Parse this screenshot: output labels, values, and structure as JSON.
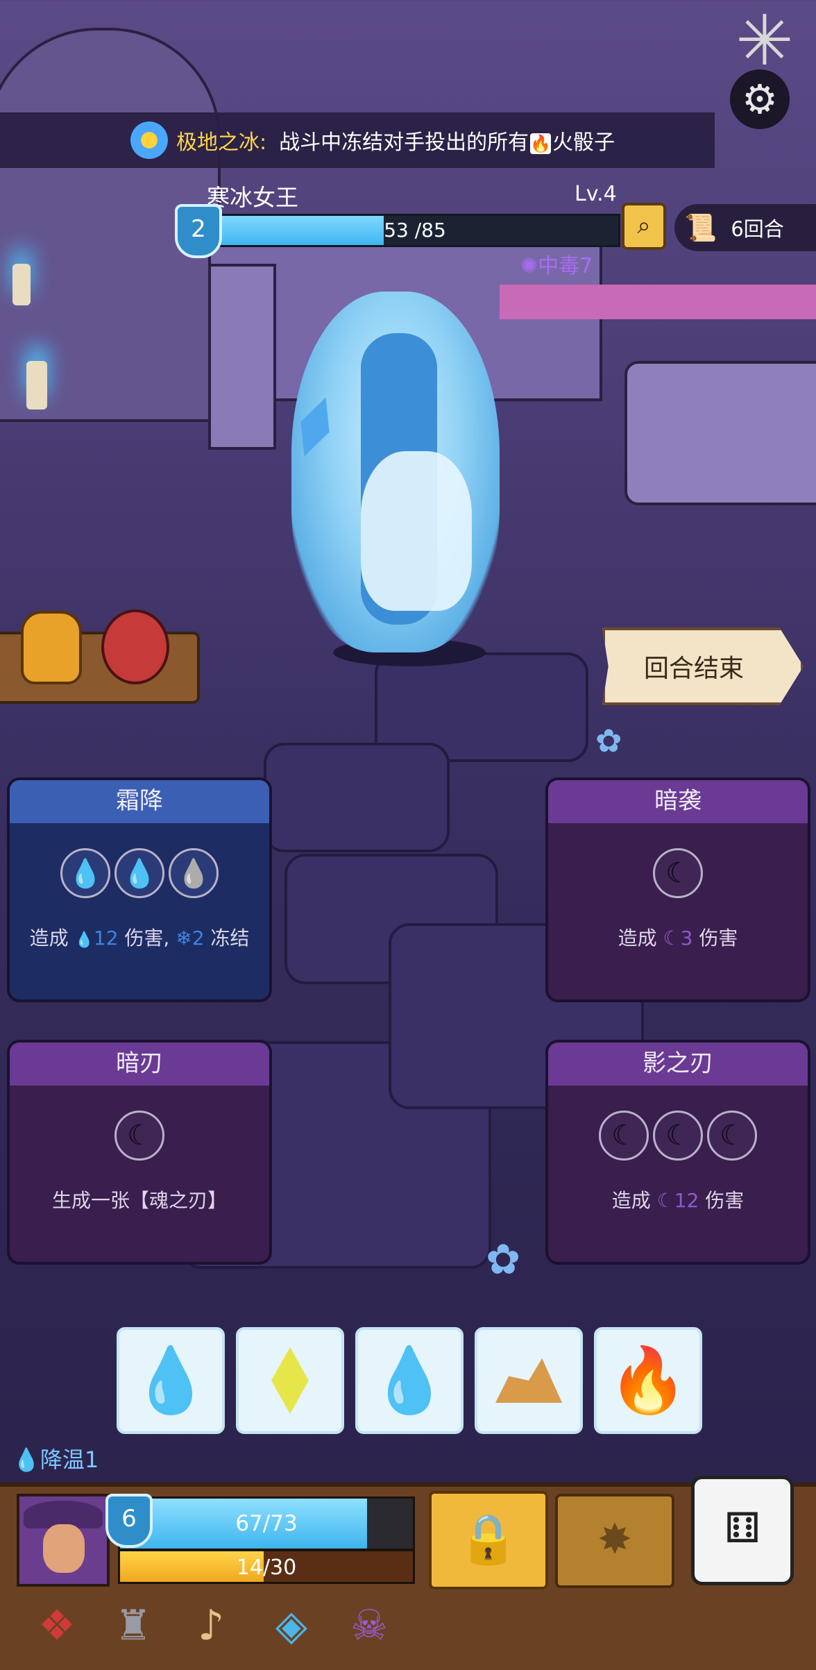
{
  "banner": {
    "title": "极地之冰:",
    "desc_prefix": "战斗中冻结对手投出的所有",
    "fire_glyph": "🔥",
    "desc_suffix": "火骰子"
  },
  "enemy": {
    "name": "寒冰女王",
    "level": "Lv.4",
    "hp_text": "53 /85",
    "hp_current": 53,
    "hp_max": 85,
    "shield": "2",
    "status": "中毒7"
  },
  "turns": "6回合",
  "end_turn_label": "回合结束",
  "cards": [
    {
      "title": "霜降",
      "desc_a": "造成 ",
      "icon_a": "💧",
      "num_a": "12",
      "desc_b": " 伤害,",
      "icon_b": "❄",
      "num_b": "2",
      "desc_c": " 冻结"
    },
    {
      "title": "暗袭",
      "desc_a": "造成 ",
      "icon_a": "☾",
      "num_a": "3",
      "desc_b": " 伤害"
    },
    {
      "title": "暗刃",
      "desc": "生成一张【魂之刃】"
    },
    {
      "title": "影之刃",
      "desc_a": "造成 ",
      "icon_a": "☾",
      "num_a": "12",
      "desc_b": " 伤害"
    }
  ],
  "status_effect": "降温1",
  "player": {
    "shield": "6",
    "hp_text": "67/73",
    "hp_current": 67,
    "hp_max": 73,
    "xp_text": "14/30",
    "xp_current": 14,
    "xp_max": 30
  },
  "icons": {
    "settings": "gear-icon",
    "magnify": "magnifier-icon",
    "turn": "scroll-icon",
    "lock": "lock-icon",
    "dice": "dice-icon"
  }
}
